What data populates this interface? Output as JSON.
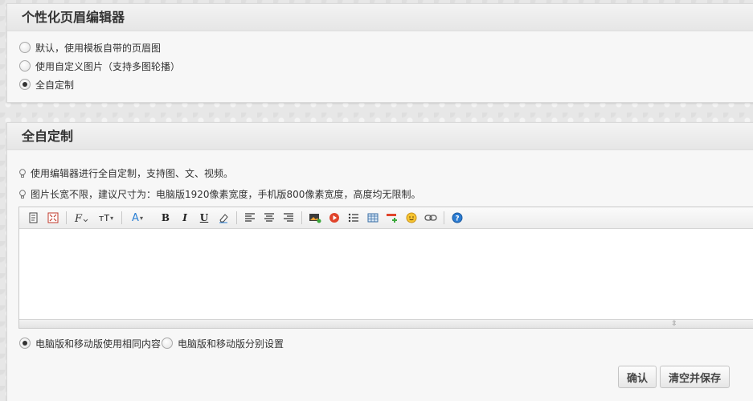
{
  "panel1": {
    "title": "个性化页眉编辑器",
    "options": [
      {
        "label": "默认，使用模板自带的页眉图",
        "checked": false
      },
      {
        "label": "使用自定义图片（支持多图轮播）",
        "checked": false
      },
      {
        "label": "全自定制",
        "checked": true
      }
    ]
  },
  "panel2": {
    "title": "全自定制",
    "tips": [
      "使用编辑器进行全自定制，支持图、文、视频。",
      "图片长宽不限，建议尺寸为：电脑版1920像素宽度，手机版800像素宽度，高度均无限制。"
    ],
    "toolbar": {
      "bold": "B",
      "italic": "I",
      "underline": "U",
      "font_size": "тT",
      "font_color": "A"
    },
    "editor_content": "",
    "layout_options": [
      {
        "label": "电脑版和移动版使用相同内容",
        "checked": true
      },
      {
        "label": "电脑版和移动版分别设置",
        "checked": false
      }
    ],
    "confirm_label": "确认",
    "clear_save_label": "清空并保存"
  },
  "colors": {
    "background": "#e7e7e7",
    "panel": "#f7f7f7",
    "accent_blue": "#2a7fd4",
    "video_red": "#e0442b",
    "help_blue": "#2b7bd1"
  }
}
